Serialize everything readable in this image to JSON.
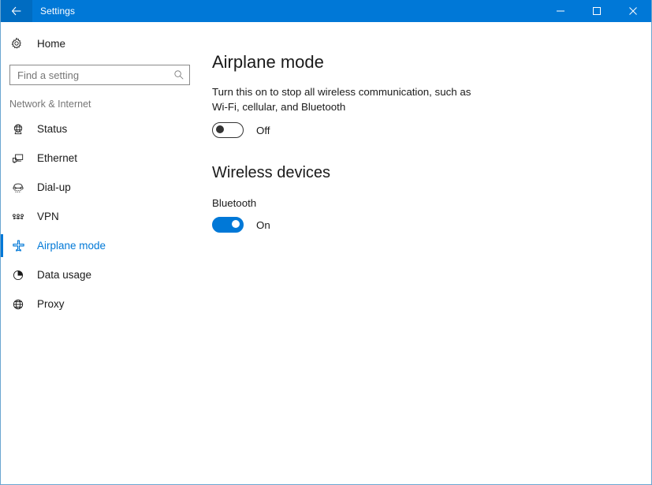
{
  "window": {
    "title": "Settings",
    "accent_color": "#0078d7",
    "border_color": "#6ba6d1",
    "back_icon": "back-arrow-icon",
    "caption": {
      "minimize": "minimize-icon",
      "maximize": "maximize-icon",
      "close": "close-icon"
    }
  },
  "sidebar": {
    "home": {
      "label": "Home",
      "icon": "gear-icon"
    },
    "search": {
      "placeholder": "Find a setting",
      "value": "",
      "icon": "search-icon"
    },
    "category": "Network & Internet",
    "items": [
      {
        "label": "Status",
        "icon": "network-globe-icon",
        "selected": false
      },
      {
        "label": "Ethernet",
        "icon": "monitor-icon",
        "selected": false
      },
      {
        "label": "Dial-up",
        "icon": "telephone-icon",
        "selected": false
      },
      {
        "label": "VPN",
        "icon": "vpn-icon",
        "selected": false
      },
      {
        "label": "Airplane mode",
        "icon": "airplane-icon",
        "selected": true
      },
      {
        "label": "Data usage",
        "icon": "pie-chart-icon",
        "selected": false
      },
      {
        "label": "Proxy",
        "icon": "globe-icon",
        "selected": false
      }
    ]
  },
  "content": {
    "page_title": "Airplane mode",
    "description": "Turn this on to stop all wireless communication, such as Wi-Fi, cellular, and Bluetooth",
    "airplane_toggle": {
      "state": "Off",
      "on": false
    },
    "wireless_section": {
      "heading": "Wireless devices",
      "bluetooth_label": "Bluetooth",
      "bluetooth_toggle": {
        "state": "On",
        "on": true
      }
    }
  }
}
